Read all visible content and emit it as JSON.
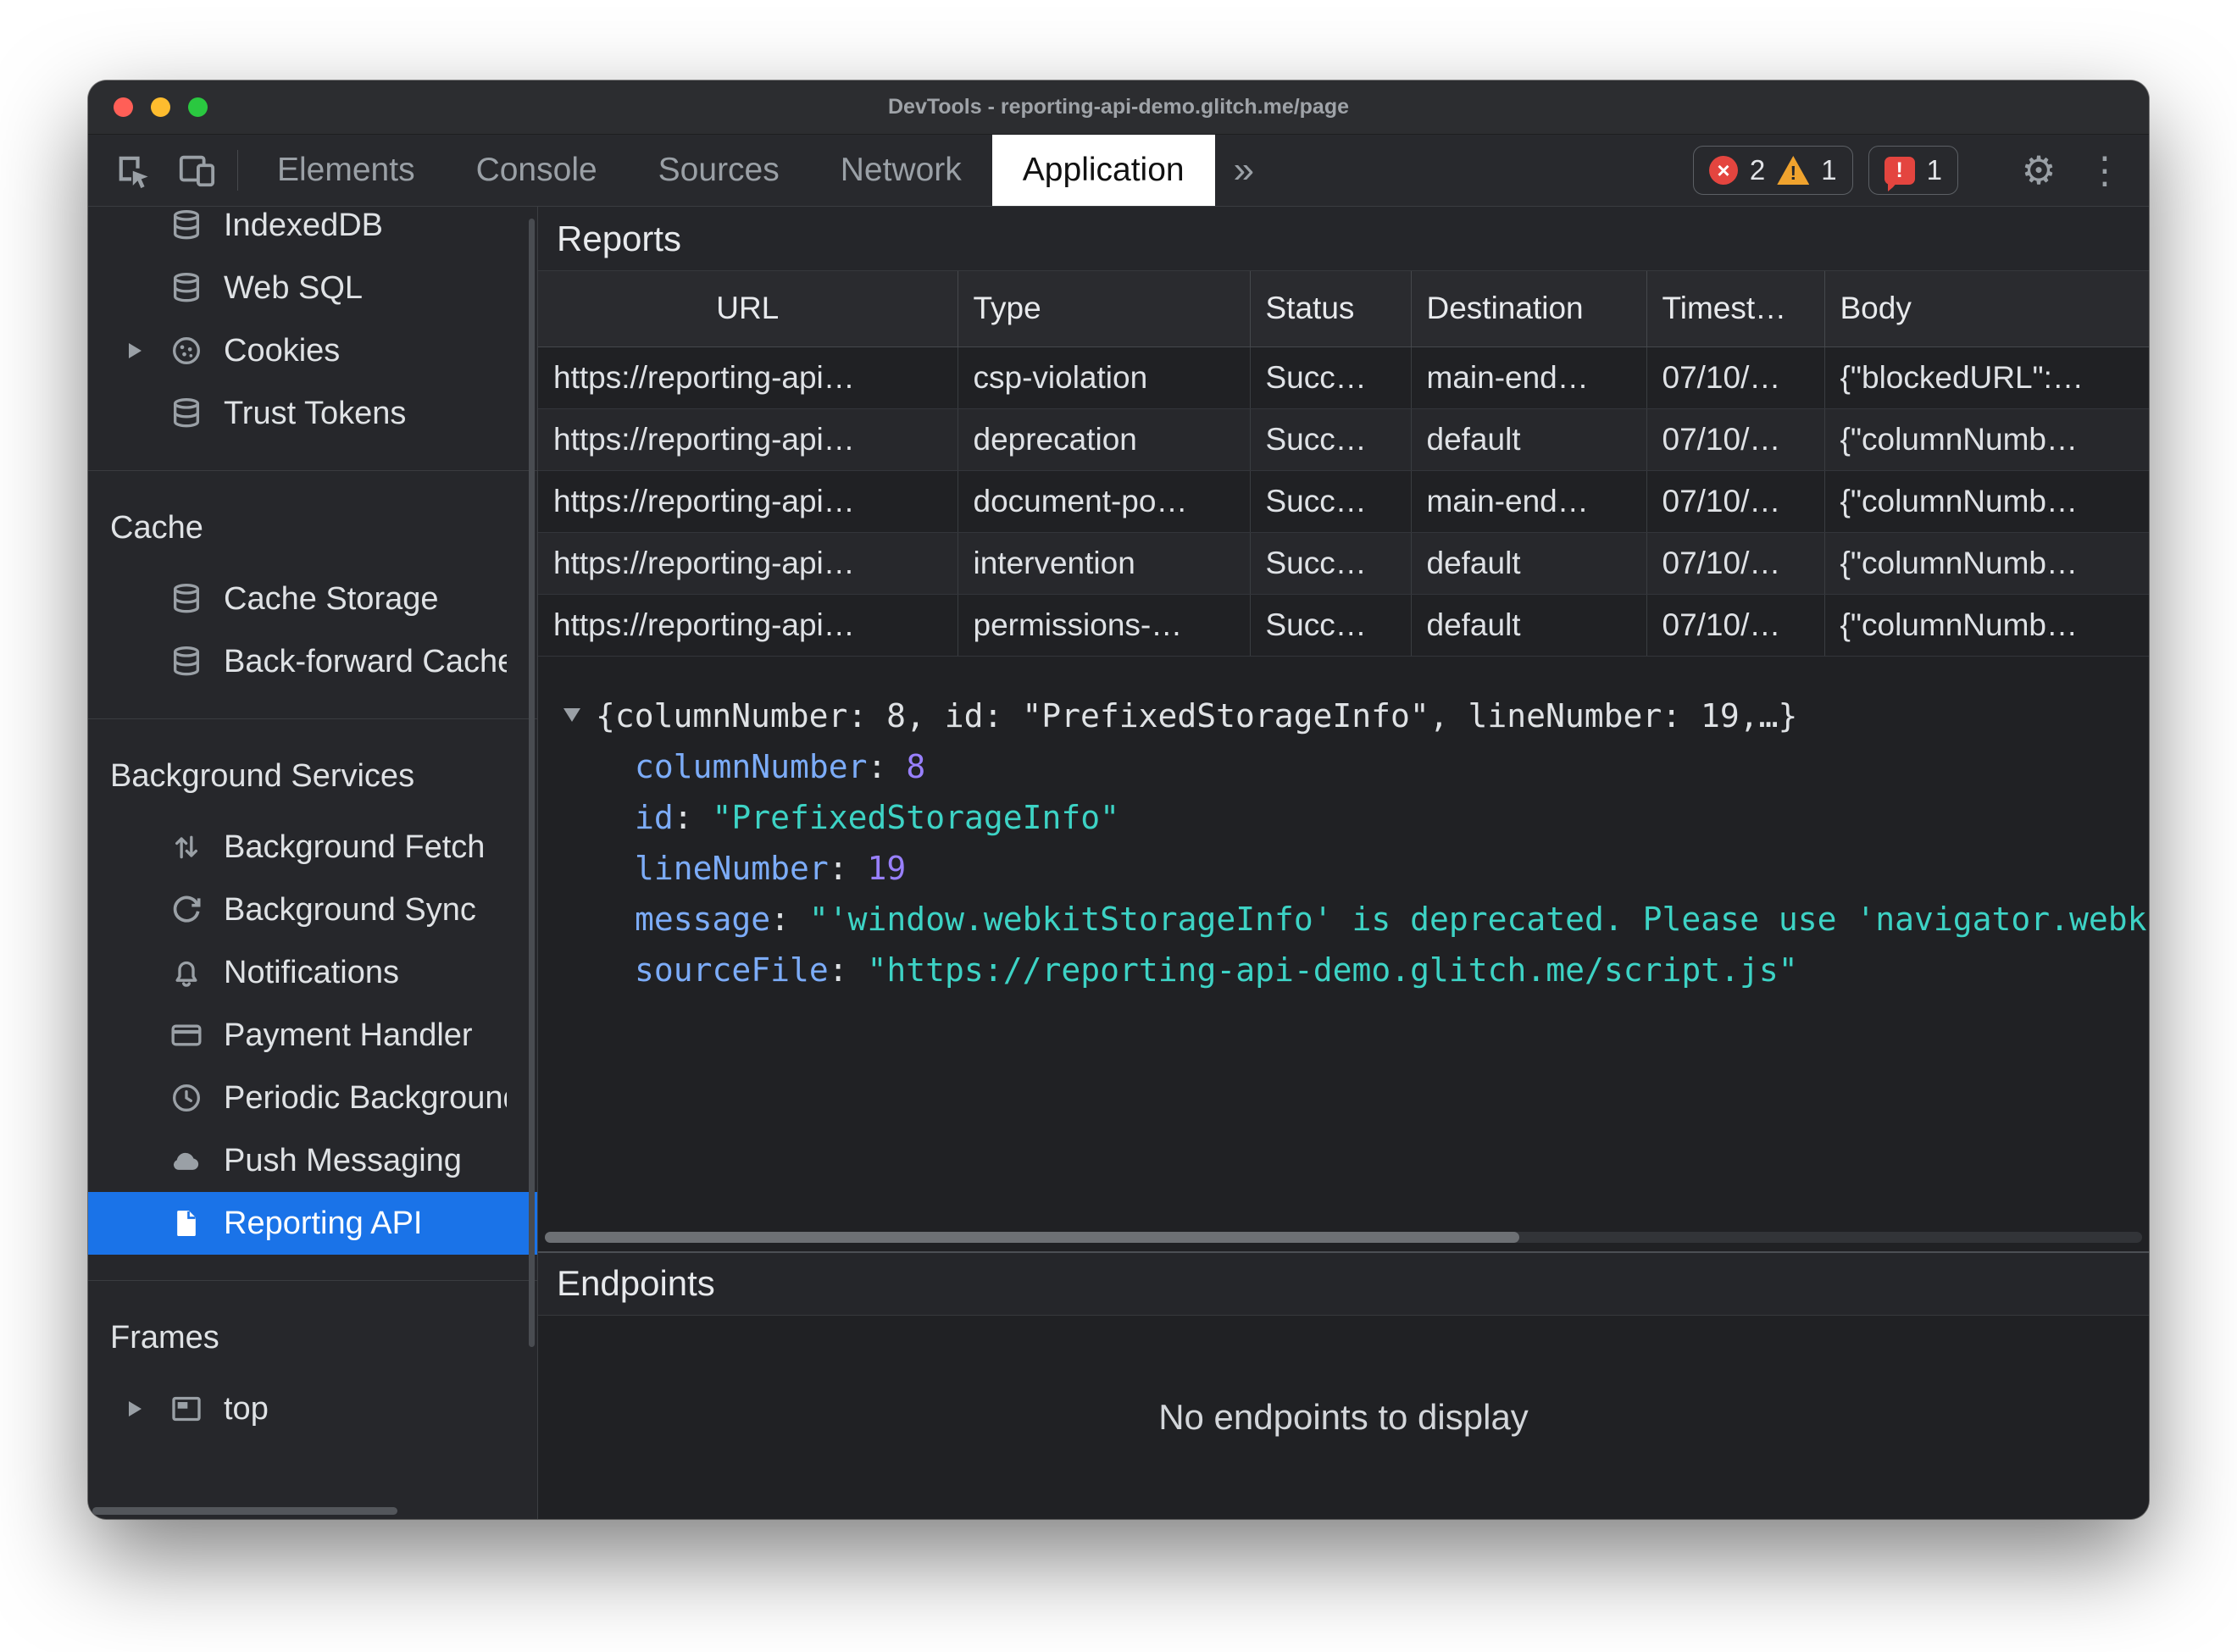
{
  "window": {
    "title": "DevTools - reporting-api-demo.glitch.me/page"
  },
  "toolbar": {
    "tabs": [
      "Elements",
      "Console",
      "Sources",
      "Network",
      "Application"
    ],
    "active_tab": "Application",
    "more_tabs": "»",
    "error_count": "2",
    "warning_count": "1",
    "issue_count": "1"
  },
  "sidebar": {
    "selected": "Reporting API",
    "sections": [
      {
        "items": [
          {
            "label": "IndexedDB",
            "icon": "database-icon"
          },
          {
            "label": "Web SQL",
            "icon": "database-icon"
          },
          {
            "label": "Cookies",
            "icon": "cookie-icon"
          },
          {
            "label": "Trust Tokens",
            "icon": "database-icon"
          }
        ]
      },
      {
        "header": "Cache",
        "items": [
          {
            "label": "Cache Storage",
            "icon": "database-icon"
          },
          {
            "label": "Back-forward Cache",
            "icon": "database-icon"
          }
        ]
      },
      {
        "header": "Background Services",
        "items": [
          {
            "label": "Background Fetch",
            "icon": "up-down-arrows-icon"
          },
          {
            "label": "Background Sync",
            "icon": "sync-icon"
          },
          {
            "label": "Notifications",
            "icon": "bell-icon"
          },
          {
            "label": "Payment Handler",
            "icon": "credit-card-icon"
          },
          {
            "label": "Periodic Background Sync",
            "icon": "clock-icon"
          },
          {
            "label": "Push Messaging",
            "icon": "cloud-icon"
          },
          {
            "label": "Reporting API",
            "icon": "document-icon"
          }
        ]
      },
      {
        "header": "Frames",
        "items": [
          {
            "label": "top",
            "icon": "frame-icon"
          }
        ]
      }
    ]
  },
  "reports": {
    "title": "Reports",
    "columns": [
      "URL",
      "Type",
      "Status",
      "Destination",
      "Timest…",
      "Body"
    ],
    "rows": [
      {
        "url": "https://reporting-api…",
        "type": "csp-violation",
        "status": "Succ…",
        "destination": "main-end…",
        "timestamp": "07/10/…",
        "body": "{\"blockedURL\":…"
      },
      {
        "url": "https://reporting-api…",
        "type": "deprecation",
        "status": "Succ…",
        "destination": "default",
        "timestamp": "07/10/…",
        "body": "{\"columnNumb…"
      },
      {
        "url": "https://reporting-api…",
        "type": "document-po…",
        "status": "Succ…",
        "destination": "main-end…",
        "timestamp": "07/10/…",
        "body": "{\"columnNumb…"
      },
      {
        "url": "https://reporting-api…",
        "type": "intervention",
        "status": "Succ…",
        "destination": "default",
        "timestamp": "07/10/…",
        "body": "{\"columnNumb…"
      },
      {
        "url": "https://reporting-api…",
        "type": "permissions-…",
        "status": "Succ…",
        "destination": "default",
        "timestamp": "07/10/…",
        "body": "{\"columnNumb…"
      }
    ]
  },
  "detail": {
    "preview": "{columnNumber: 8, id: \"PrefixedStorageInfo\", lineNumber: 19,…}",
    "properties": [
      {
        "key": "columnNumber",
        "value": "8",
        "type": "number"
      },
      {
        "key": "id",
        "value": "\"PrefixedStorageInfo\"",
        "type": "string"
      },
      {
        "key": "lineNumber",
        "value": "19",
        "type": "number"
      },
      {
        "key": "message",
        "value": "\"'window.webkitStorageInfo' is deprecated. Please use 'navigator.webkitTemporaryStorage' or 'navigator.webkitPersistentStorage' instead.\"",
        "type": "string"
      },
      {
        "key": "sourceFile",
        "value": "\"https://reporting-api-demo.glitch.me/script.js\"",
        "type": "string"
      }
    ]
  },
  "endpoints": {
    "title": "Endpoints",
    "empty_message": "No endpoints to display"
  },
  "colors": {
    "accent-blue": "#1a73e8",
    "error-red": "#e4453f",
    "warning-yellow": "#f0a32e",
    "key-blue": "#7cacf8",
    "number-purple": "#9980ff",
    "string-teal": "#3dd3c5"
  }
}
